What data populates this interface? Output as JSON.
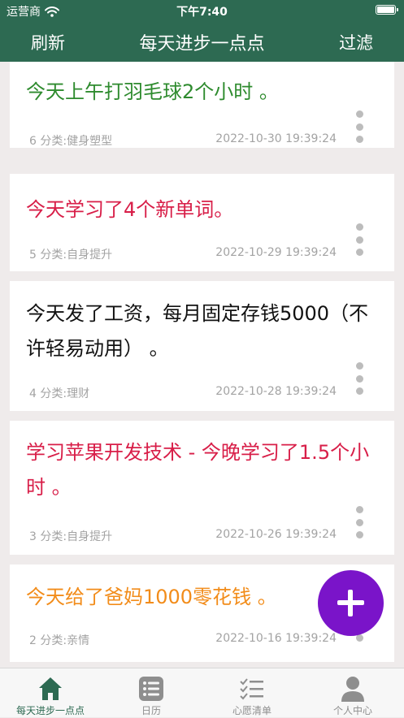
{
  "status_bar": {
    "carrier": "运营商",
    "time": "下午7:40",
    "icons": [
      "wifi-icon",
      "battery-icon"
    ]
  },
  "nav": {
    "refresh": "刷新",
    "title": "每天进步一点点",
    "filter": "过滤"
  },
  "colors": {
    "primary": "#2d6a52",
    "fab": "#7a14c9",
    "green": "#2e8b2e",
    "red": "#d81e48",
    "black": "#111111",
    "orange": "#f28c1a"
  },
  "items": [
    {
      "text": "今天上午打羽毛球2个小时 。",
      "category": "6 分类:健身塑型",
      "date": "2022-10-30 19:39:24",
      "color": "#2e8b2e"
    },
    {
      "text": "今天学习了4个新单词。",
      "category": "5 分类:自身提升",
      "date": "2022-10-29 19:39:24",
      "color": "#d81e48"
    },
    {
      "text": "今天发了工资，每月固定存钱5000（不许轻易动用）  。",
      "category": "4 分类:理财",
      "date": "2022-10-28 19:39:24",
      "color": "#111111"
    },
    {
      "text": "学习苹果开发技术 - 今晚学习了1.5个小时 。",
      "category": "3 分类:自身提升",
      "date": "2022-10-26 19:39:24",
      "color": "#d81e48"
    },
    {
      "text": "今天给了爸妈1000零花钱 。",
      "category": "2 分类:亲情",
      "date": "2022-10-16 19:39:24",
      "color": "#f28c1a"
    }
  ],
  "tabs": [
    {
      "label": "每天进步一点点",
      "icon": "home-icon",
      "active": true
    },
    {
      "label": "日历",
      "icon": "calendar-list-icon",
      "active": false
    },
    {
      "label": "心愿清单",
      "icon": "checklist-icon",
      "active": false
    },
    {
      "label": "个人中心",
      "icon": "person-icon",
      "active": false
    }
  ]
}
